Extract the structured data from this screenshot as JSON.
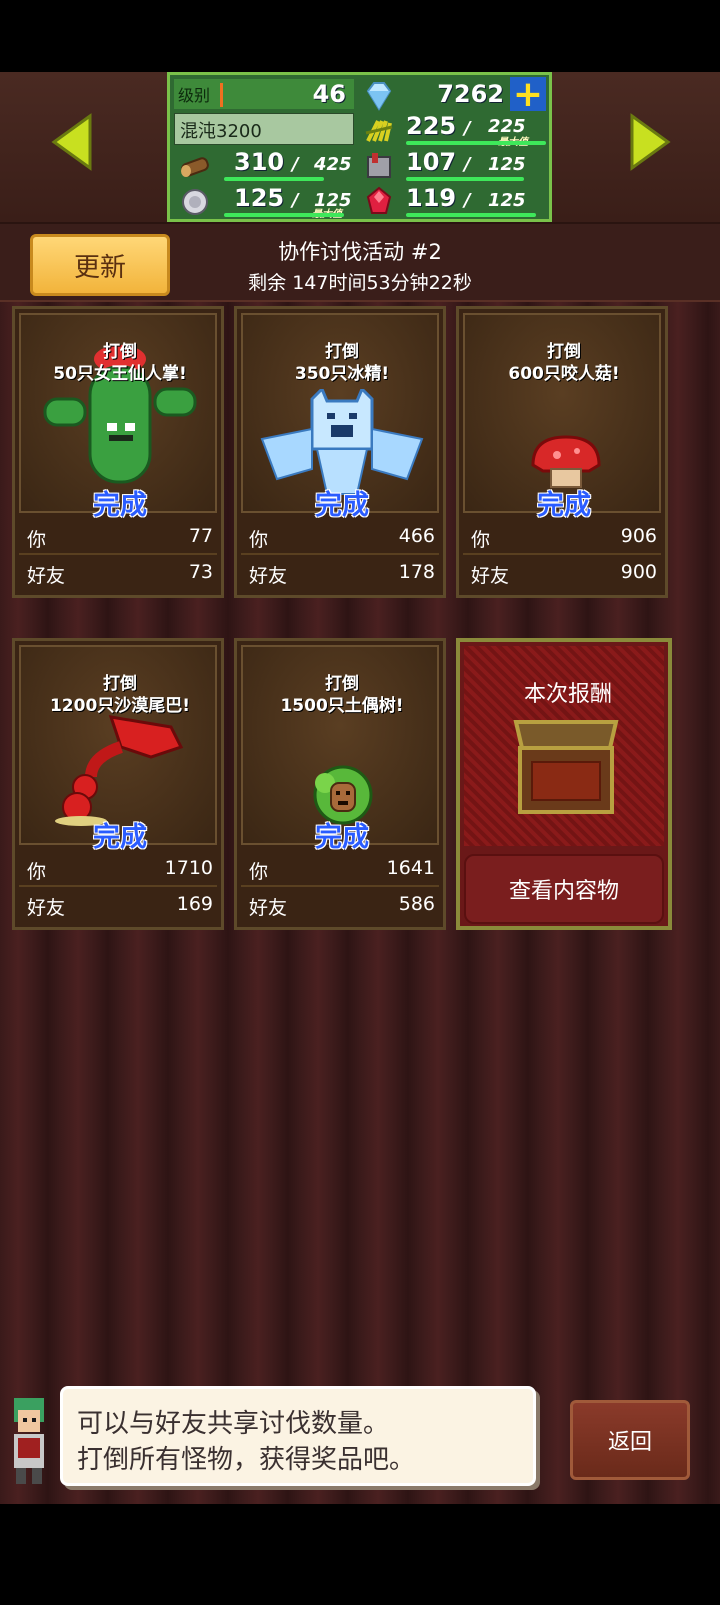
{
  "top": {
    "level_label": "级别",
    "level": "46",
    "gems": "7262",
    "plus": "+",
    "chaos": "混沌3200",
    "resources": [
      {
        "icon": "wheat-icon",
        "value": "225",
        "max": "225",
        "tag": "最大值"
      },
      {
        "icon": "wood-icon",
        "value": "310",
        "max": "425"
      },
      {
        "icon": "ore-icon",
        "value": "107",
        "max": "125"
      },
      {
        "icon": "coin-icon",
        "value": "125",
        "max": "125",
        "tag": "最大值"
      },
      {
        "icon": "ruby-icon",
        "value": "119",
        "max": "125"
      }
    ],
    "slash": "/"
  },
  "header": {
    "update_label": "更新",
    "event_title": "协作讨伐活动 #2",
    "remaining": "剩余 147时间53分钟22秒"
  },
  "labels": {
    "you": "你",
    "friends": "好友",
    "done": "完成"
  },
  "cards": [
    {
      "title1": "打倒",
      "title2": "50只女王仙人掌!",
      "you": "77",
      "friends": "73",
      "monster": "cactus-queen-icon"
    },
    {
      "title1": "打倒",
      "title2": "350只冰精!",
      "you": "466",
      "friends": "178",
      "monster": "ice-spirit-icon"
    },
    {
      "title1": "打倒",
      "title2": "600只咬人菇!",
      "you": "906",
      "friends": "900",
      "monster": "biting-mushroom-icon"
    },
    {
      "title1": "打倒",
      "title2": "1200只沙漠尾巴!",
      "you": "1710",
      "friends": "169",
      "monster": "desert-tail-icon"
    },
    {
      "title1": "打倒",
      "title2": "1500只土偶树!",
      "you": "1641",
      "friends": "586",
      "monster": "clay-tree-icon"
    }
  ],
  "reward": {
    "title": "本次报酬",
    "button": "查看内容物"
  },
  "dialog": {
    "line1": "可以与好友共享讨伐数量。",
    "line2": "打倒所有怪物，获得奖品吧。"
  },
  "return_label": "返回",
  "colors": {
    "done": "#2a5cff",
    "stats_bg": "#2f6a32",
    "update_btn": "#f2b43b"
  }
}
